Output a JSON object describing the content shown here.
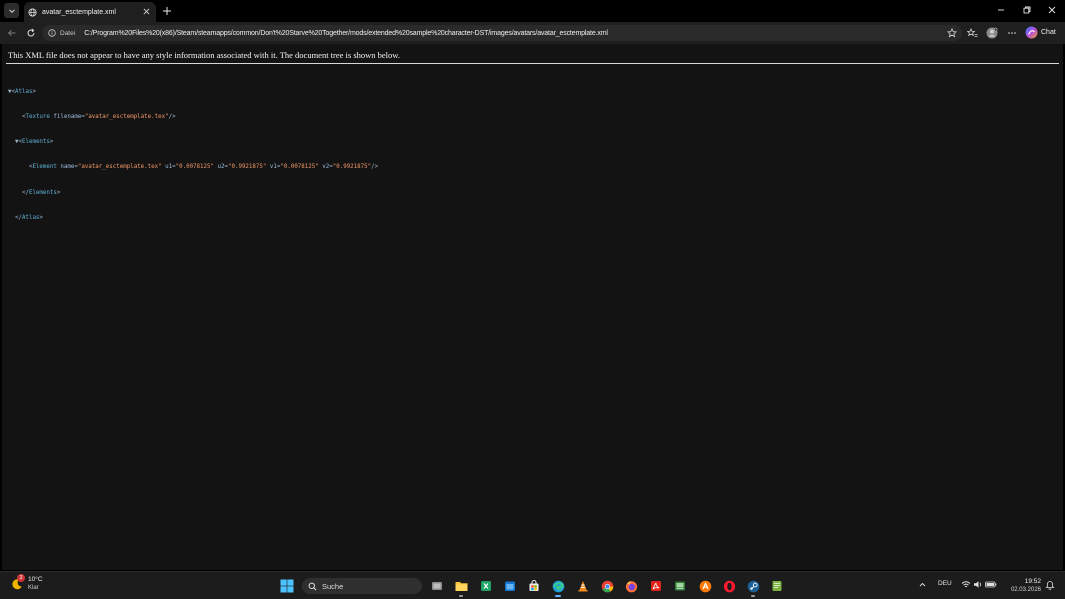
{
  "browser": {
    "tab_title": "avatar_esctemplate.xml",
    "address_label": "Datei",
    "url": "C:/Program%20Files%20(x86)/Steam/steamapps/common/Don't%20Starve%20Together/mods/extended%20sample%20character-DST/images/avatars/avatar_esctemplate.xml",
    "copilot_label": "Chat"
  },
  "content": {
    "notice": "This XML file does not appear to have any style information associated with it. The document tree is shown below.",
    "xml": {
      "atlas_tag": "Atlas",
      "texture_tag": "Texture",
      "texture_attr": "filename",
      "texture_value": "\"avatar_esctemplate.tex\"",
      "elements_tag": "Elements",
      "element_tag": "Element",
      "element_name_attr": "name",
      "element_name_value": "\"avatar_esctemplate.tex\"",
      "u1_attr": "u1",
      "u1_value": "\"0.0078125\"",
      "u2_attr": "u2",
      "u2_value": "\"0.9921875\"",
      "v1_attr": "v1",
      "v1_value": "\"0.0078125\"",
      "v2_attr": "v2",
      "v2_value": "\"0.9921875\""
    }
  },
  "taskbar": {
    "weather_temp": "10°C",
    "weather_condition": "Klar",
    "weather_badge": "2",
    "search_placeholder": "Suche",
    "language": "DEU",
    "time": "19:52",
    "date": "02.03.2026"
  },
  "colors": {
    "background": "#131313",
    "tag": "#5db0d7",
    "value": "#f29766",
    "taskbar": "#1c1c1c"
  }
}
